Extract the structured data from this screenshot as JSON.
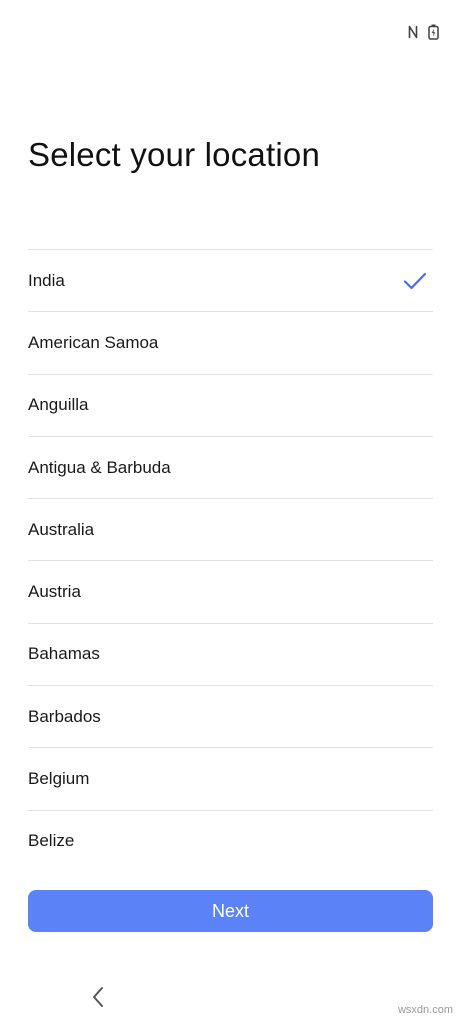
{
  "status_bar": {
    "icons": [
      "nfc-icon",
      "battery-charging-icon"
    ]
  },
  "page": {
    "title": "Select your location"
  },
  "locations": [
    {
      "label": "India",
      "selected": true
    },
    {
      "label": "American Samoa",
      "selected": false
    },
    {
      "label": "Anguilla",
      "selected": false
    },
    {
      "label": "Antigua & Barbuda",
      "selected": false
    },
    {
      "label": "Australia",
      "selected": false
    },
    {
      "label": "Austria",
      "selected": false
    },
    {
      "label": "Bahamas",
      "selected": false
    },
    {
      "label": "Barbados",
      "selected": false
    },
    {
      "label": "Belgium",
      "selected": false
    },
    {
      "label": "Belize",
      "selected": false
    }
  ],
  "actions": {
    "next_label": "Next"
  },
  "nav": {
    "back_icon": "chevron-left-icon"
  },
  "watermark": "wsxdn.com",
  "colors": {
    "accent": "#5c82f8",
    "check": "#4a6cf0",
    "divider": "#e2e2e2"
  }
}
